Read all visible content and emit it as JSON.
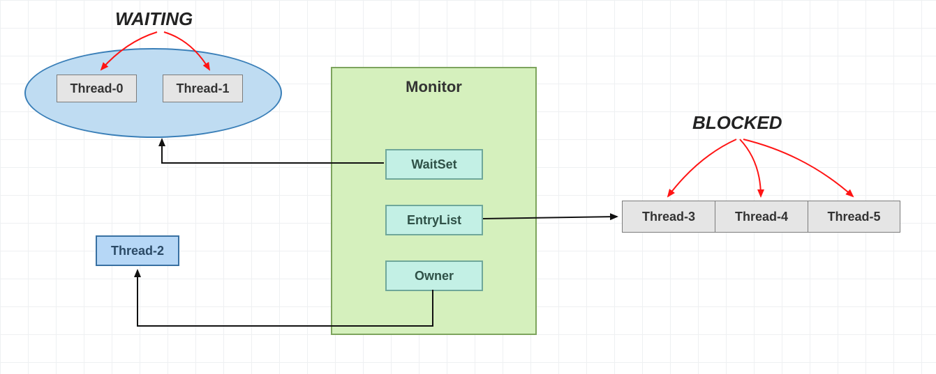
{
  "labels": {
    "waiting": "WAITING",
    "blocked": "BLOCKED"
  },
  "monitor": {
    "title": "Monitor",
    "fields": {
      "waitset": "WaitSet",
      "entrylist": "EntryList",
      "owner": "Owner"
    }
  },
  "threads": {
    "waiting": [
      "Thread-0",
      "Thread-1"
    ],
    "owner": "Thread-2",
    "blocked": [
      "Thread-3",
      "Thread-4",
      "Thread-5"
    ]
  },
  "colors": {
    "ellipse_fill": "#bfdcf2",
    "ellipse_stroke": "#3a7fb8",
    "monitor_fill": "#d5f0bd",
    "monitor_stroke": "#7da45d",
    "field_fill": "#c3f0e5",
    "field_stroke": "#6fa79a",
    "thread_fill": "#e5e5e5",
    "thread_stroke": "#7b7b7b",
    "owner_fill": "#b6d7f6",
    "owner_stroke": "#3870a2",
    "arrow_red": "#ff1414",
    "arrow_black": "#111111"
  }
}
